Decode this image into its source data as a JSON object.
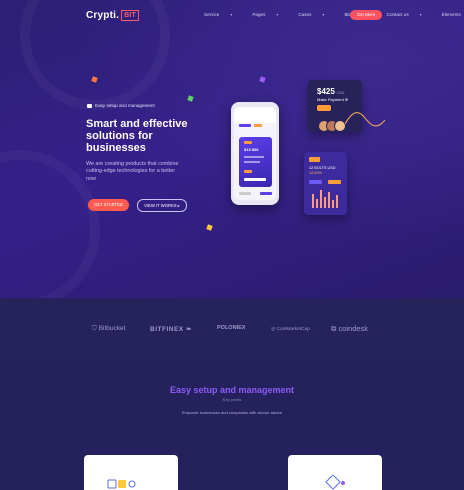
{
  "brand": {
    "name": "Crypti.",
    "suffix": "BIT"
  },
  "nav": {
    "items": [
      {
        "label": "Service",
        "active": true
      },
      {
        "label": "Pages",
        "active": false
      },
      {
        "label": "Cases",
        "active": false
      },
      {
        "label": "Blog",
        "active": false
      },
      {
        "label": "Contact us",
        "active": false
      },
      {
        "label": "Elements",
        "active": false
      }
    ],
    "cta": "Get token"
  },
  "hero": {
    "eyebrow": "Easy setup and management",
    "title": "Smart and effective solutions for businesses",
    "subtitle": "We are creating products that combine cutting-edge technologies for a better now",
    "primary_button": "GET STARTED",
    "secondary_button": "VIEW IT WORKS ▸"
  },
  "mockup": {
    "payment_value": "$425",
    "payment_unit": "USD",
    "payment_label": "Make Payment ⊕",
    "card_amount": "$13 806",
    "chart_line1": "12 BOLTS USD",
    "chart_line2": "12,00%"
  },
  "partners": [
    "Bitbucket",
    "BITFINEX",
    "POLONIEX",
    "CoinMarketCap",
    "coindesk"
  ],
  "section": {
    "title": "Easy setup and management",
    "subtitle": "Key points",
    "description": "Empower businesses and companies with secure advice"
  },
  "colors": {
    "accent": "#ff5361",
    "purple": "#8c5cf5",
    "background": "#23205a"
  }
}
